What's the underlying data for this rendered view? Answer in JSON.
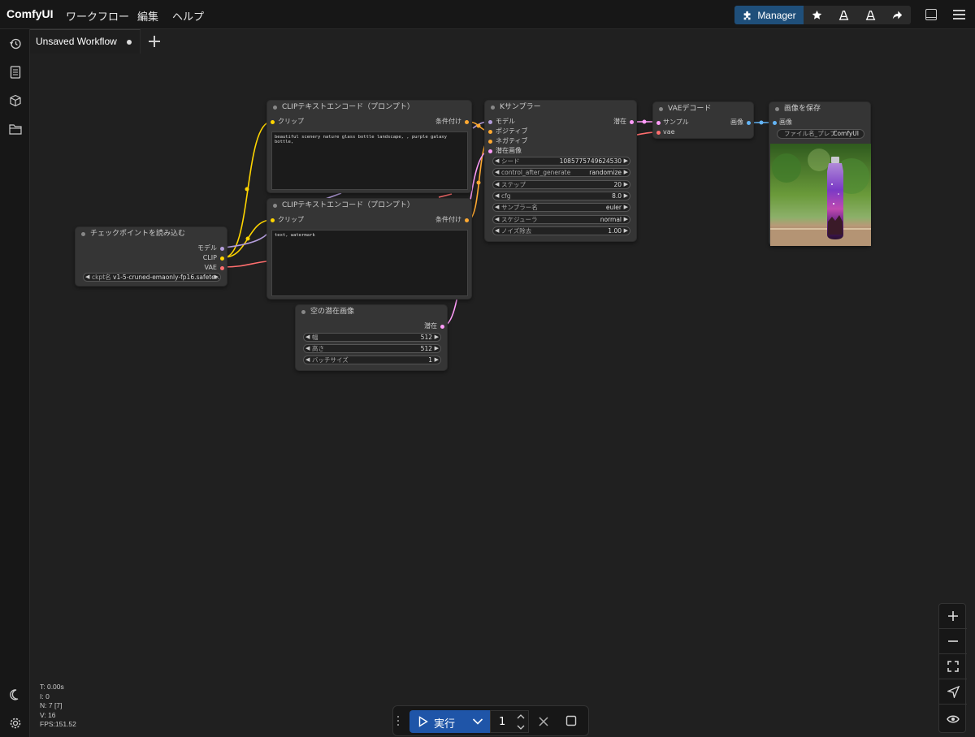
{
  "app": {
    "title": "ComfyUI"
  },
  "menu": {
    "workflow": "ワークフロー",
    "edit": "編集",
    "help": "ヘルプ"
  },
  "toolbar": {
    "manager_label": "Manager"
  },
  "tabs": {
    "active_label": "Unsaved Workflow"
  },
  "nodes": {
    "checkpoint": {
      "title": "チェックポイントを読み込む",
      "outputs": [
        "モデル",
        "CLIP",
        "VAE"
      ],
      "widget_label": "ckpt名",
      "widget_value": "v1-5-cruned-emaonly-fp16.safete..."
    },
    "clip_pos": {
      "title": "CLIPテキストエンコード（プロンプト）",
      "input": "クリップ",
      "output": "条件付け",
      "text": "beautiful scenery nature glass bottle landscape, , purple galaxy bottle,"
    },
    "clip_neg": {
      "title": "CLIPテキストエンコード（プロンプト）",
      "input": "クリップ",
      "output": "条件付け",
      "text": "text, watermark"
    },
    "ksampler": {
      "title": "Kサンプラー",
      "inputs": [
        "モデル",
        "ポジティブ",
        "ネガティブ",
        "潜在画像"
      ],
      "output": "潜在",
      "widgets": [
        {
          "label": "シード",
          "value": "1085775749624530"
        },
        {
          "label": "control_after_generate",
          "value": "randomize"
        },
        {
          "label": "ステップ",
          "value": "20"
        },
        {
          "label": "cfg",
          "value": "8.0"
        },
        {
          "label": "サンプラー名",
          "value": "euler"
        },
        {
          "label": "スケジューラ",
          "value": "normal"
        },
        {
          "label": "ノイズ除去",
          "value": "1.00"
        }
      ]
    },
    "vae_decode": {
      "title": "VAEデコード",
      "inputs": [
        "サンプル",
        "vae"
      ],
      "output": "画像"
    },
    "save_image": {
      "title": "画像を保存",
      "input": "画像",
      "widget_label": "ファイル名_プレフ",
      "widget_value": "ComfyUI"
    },
    "empty_latent": {
      "title": "空の潜在画像",
      "output": "潜在",
      "widgets": [
        {
          "label": "幅",
          "value": "512"
        },
        {
          "label": "高さ",
          "value": "512"
        },
        {
          "label": "バッチサイズ",
          "value": "1"
        }
      ]
    }
  },
  "stats": {
    "t": "T: 0.00s",
    "i": "I: 0",
    "n": "N: 7 [7]",
    "v": "V: 16",
    "fps": "FPS:151.52"
  },
  "runbar": {
    "run_label": "実行",
    "count": "1"
  },
  "colors": {
    "model": "#b39ddb",
    "clip": "#ffd500",
    "vae": "#ff6e6e",
    "conditioning": "#ffa931",
    "latent": "#ff9cf9",
    "image": "#64b5f6",
    "accent": "#1f55a8"
  }
}
